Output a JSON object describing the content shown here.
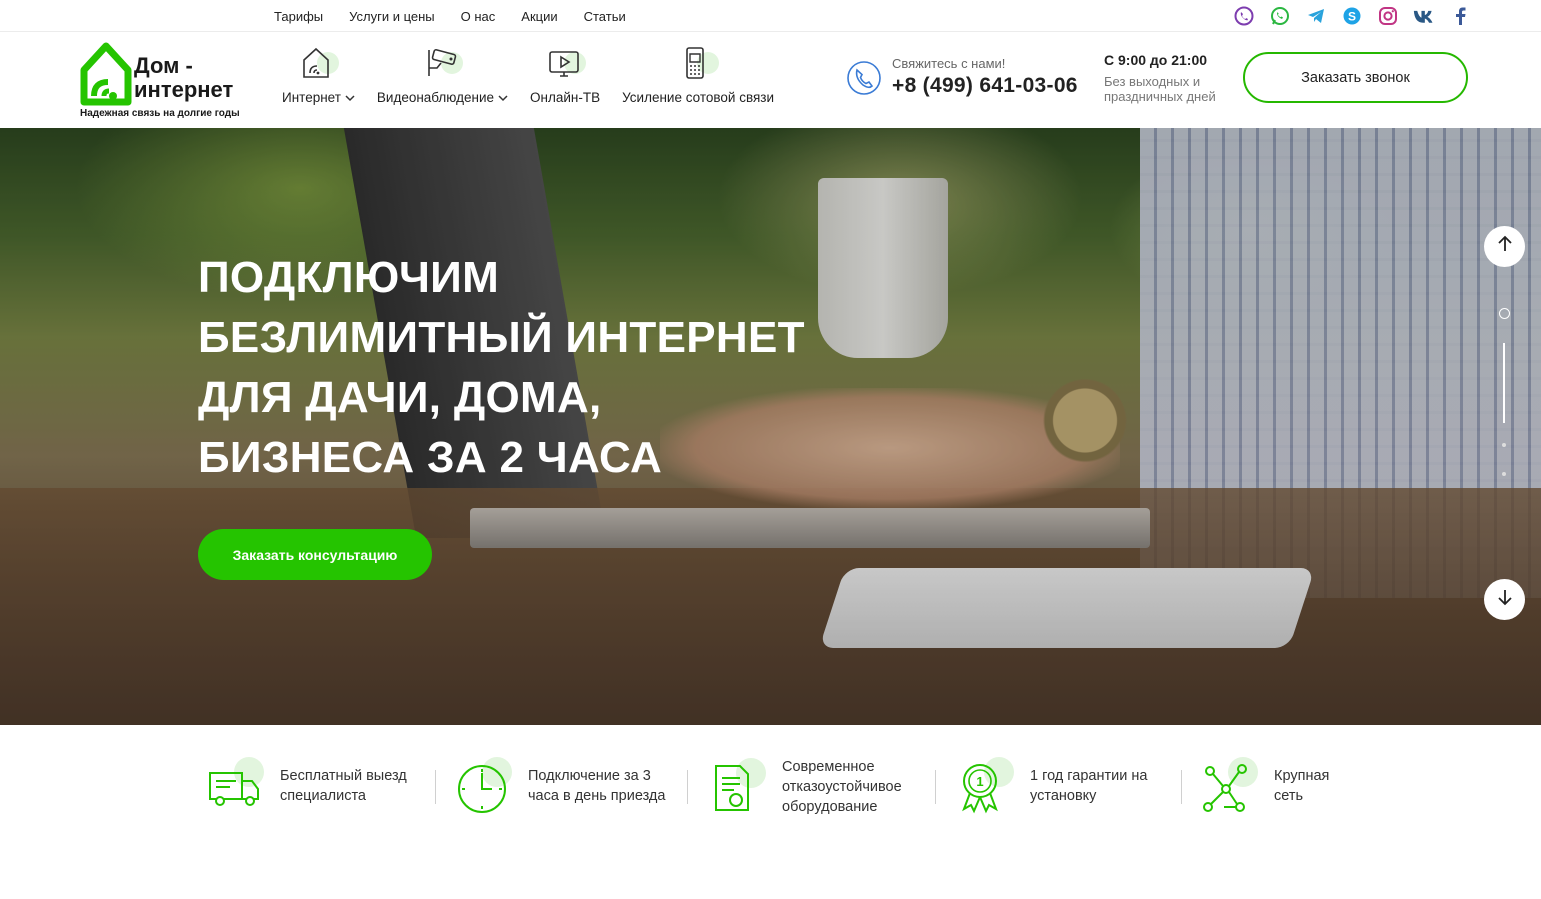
{
  "topnav": [
    "Тарифы",
    "Услуги и цены",
    "О нас",
    "Акции",
    "Статьи"
  ],
  "social_icons": [
    "viber-icon",
    "whatsapp-icon",
    "telegram-icon",
    "skype-icon",
    "instagram-icon",
    "vk-icon",
    "facebook-icon"
  ],
  "logo": {
    "title_line1": "Дом -",
    "title_line2": "интернет",
    "tagline": "Надежная связь на долгие годы"
  },
  "mainnav": [
    {
      "label": "Интернет",
      "dropdown": true,
      "icon": "wifi-house-icon"
    },
    {
      "label": "Видеонаблюдение",
      "dropdown": true,
      "icon": "cctv-camera-icon"
    },
    {
      "label": "Онлайн-ТВ",
      "dropdown": false,
      "icon": "tv-icon"
    },
    {
      "label": "Усиление сотовой связи",
      "dropdown": false,
      "icon": "cell-phone-icon"
    }
  ],
  "contact": {
    "label": "Свяжитесь с нами!",
    "phone": "+8 (499) 641-03-06"
  },
  "hours": {
    "main": "С 9:00 до 21:00",
    "sub": "Без выходных и праздничных дней"
  },
  "call_button": "Заказать звонок",
  "hero": {
    "title": "Подключим безлимитный интернет для дачи, дома, бизнеса за 2 часа",
    "button": "Заказать консультацию"
  },
  "features": [
    {
      "text": "Бесплатный выезд специалиста",
      "icon": "truck-icon"
    },
    {
      "text": "Подключение за 3 часа в день приезда",
      "icon": "clock-icon"
    },
    {
      "text": "Современное отказоустойчивое оборудование",
      "icon": "certificate-icon"
    },
    {
      "text": "1 год гарантии на установку",
      "icon": "award-medal-icon"
    },
    {
      "text": "Крупная сеть",
      "icon": "network-icon"
    }
  ],
  "colors": {
    "accent": "#25c400",
    "accent_border": "#25b800",
    "icon_blob": "#e2f5de"
  }
}
